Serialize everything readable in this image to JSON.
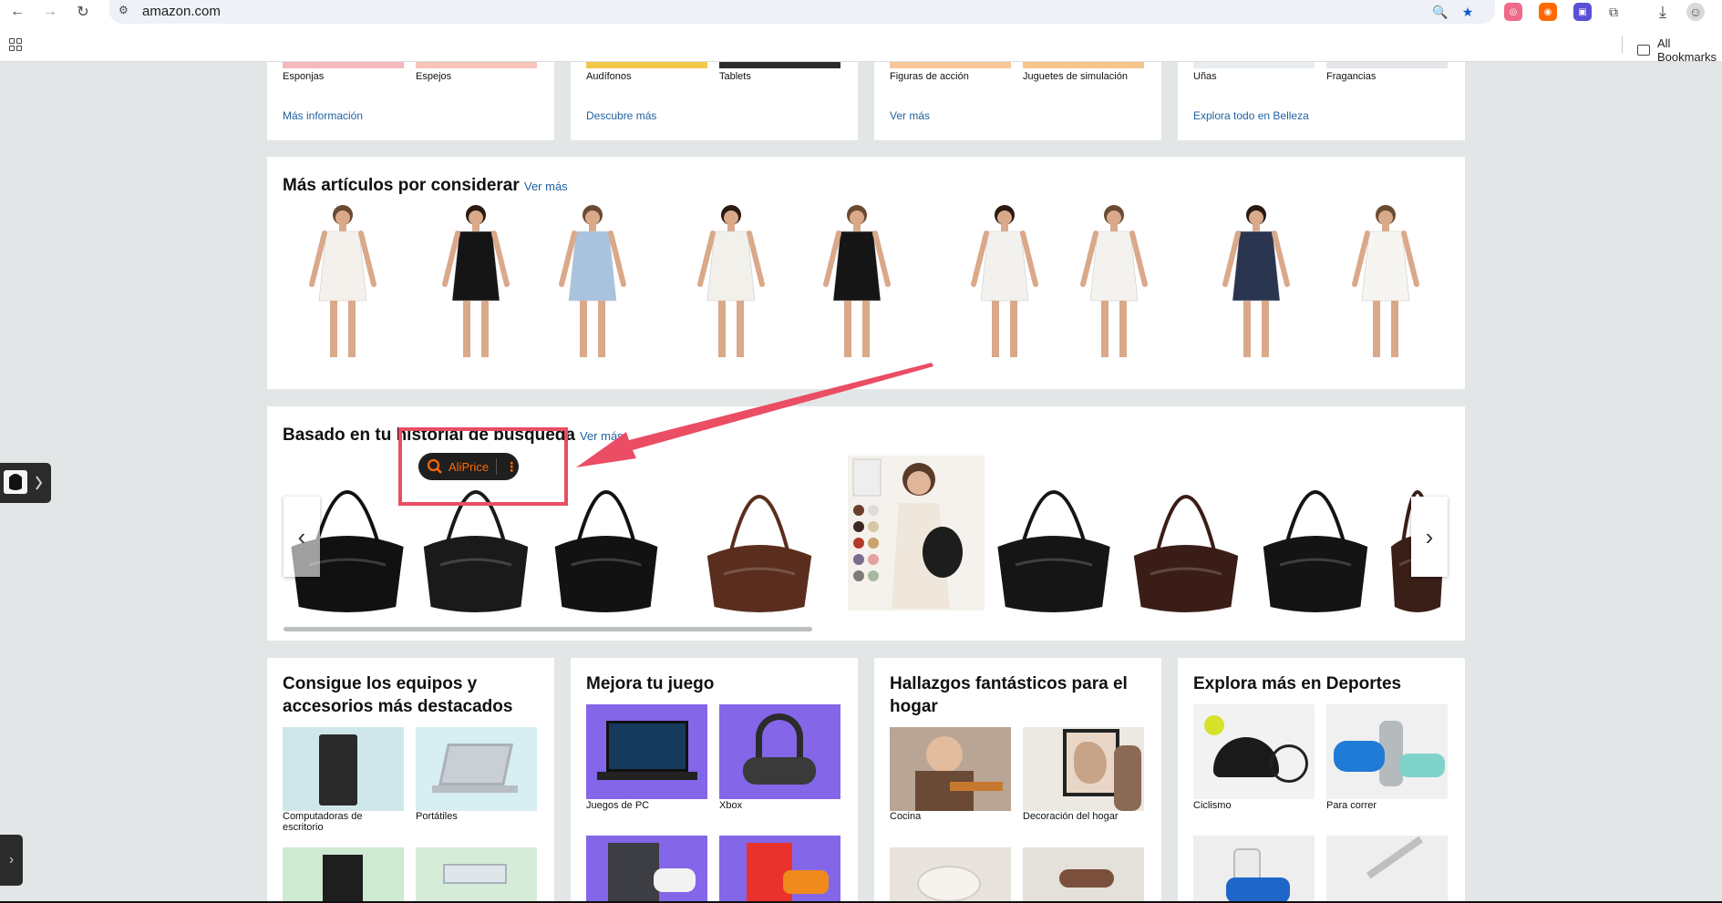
{
  "browser": {
    "url": "amazon.com",
    "bookmarks_label": "All Bookmarks",
    "extensions": [
      {
        "name": "extension-pink-icon",
        "color": "#f06a8a"
      },
      {
        "name": "extension-orange-icon",
        "color": "#ff6a00"
      },
      {
        "name": "extension-purple-icon",
        "color": "#5b4fd6"
      }
    ]
  },
  "top_cards": [
    {
      "labels": [
        "Esponjas",
        "Espejos"
      ],
      "link": "Más información"
    },
    {
      "labels": [
        "Audífonos",
        "Tablets"
      ],
      "link": "Descubre más"
    },
    {
      "labels": [
        "Figuras de acción",
        "Juguetes de simulación"
      ],
      "link": "Ver más"
    },
    {
      "labels": [
        "Uñas",
        "Fragancias"
      ],
      "link": "Explora todo en Belleza"
    }
  ],
  "more_items": {
    "title": "Más artículos por considerar",
    "link": "Ver más",
    "dresses": [
      {
        "name": "dress-white-long",
        "color": "#f4f1ec"
      },
      {
        "name": "dress-black-square",
        "color": "#151515"
      },
      {
        "name": "dress-light-blue",
        "color": "#a9c3de"
      },
      {
        "name": "dress-white-ruffle-hat",
        "color": "#f2f0eb"
      },
      {
        "name": "dress-black-long-sleeve",
        "color": "#151515"
      },
      {
        "name": "dress-white-maxi",
        "color": "#f3f1ee"
      },
      {
        "name": "dress-white-tiered",
        "color": "#f4f2ef"
      },
      {
        "name": "dress-navy-floral",
        "color": "#2a3550"
      },
      {
        "name": "dress-white-lace",
        "color": "#f6f5f2"
      }
    ]
  },
  "history": {
    "title": "Basado en tu historial de búsqueda",
    "link": "Ver más",
    "bags": [
      {
        "name": "bag-black-hobo",
        "color": "#111111"
      },
      {
        "name": "bag-black-hobo-2",
        "color": "#1a1a1a"
      },
      {
        "name": "bag-black-crescent",
        "color": "#121212"
      },
      {
        "name": "bag-brown-shoulder",
        "color": "#5a2e1e"
      },
      {
        "name": "bag-model-color-options",
        "color": "#1d1d1d"
      },
      {
        "name": "bag-black-shoulder",
        "color": "#151515"
      },
      {
        "name": "bag-dark-brown-shoulder",
        "color": "#3b1d17"
      },
      {
        "name": "bag-black-shoulder-2",
        "color": "#141414"
      },
      {
        "name": "bag-dark-brown-partial",
        "color": "#3a1e18"
      }
    ]
  },
  "aliprice": {
    "label": "AliPrice"
  },
  "bottom_cards": [
    {
      "title": "Consigue los equipos y accesorios más destacados",
      "tiles": [
        {
          "label": "Computadoras de escritorio",
          "bg": "#cfe7ea"
        },
        {
          "label": "Portátiles",
          "bg": "#d7eef2"
        },
        {
          "label": "",
          "bg": "#cfe9d2"
        },
        {
          "label": "",
          "bg": "#d5ecd8"
        }
      ]
    },
    {
      "title": "Mejora tu juego",
      "tiles": [
        {
          "label": "Juegos de PC",
          "bg": "#8466e8"
        },
        {
          "label": "Xbox",
          "bg": "#8466e8"
        },
        {
          "label": "",
          "bg": "#8466e8"
        },
        {
          "label": "",
          "bg": "#8466e8"
        }
      ]
    },
    {
      "title": "Hallazgos fantásticos para el hogar",
      "tiles": [
        {
          "label": "Cocina",
          "bg": "#b9a595"
        },
        {
          "label": "Decoración del hogar",
          "bg": "#ece8e2"
        },
        {
          "label": "",
          "bg": "#e8e3dc"
        },
        {
          "label": "",
          "bg": "#e4e0da"
        }
      ]
    },
    {
      "title": "Explora más en Deportes",
      "tiles": [
        {
          "label": "Ciclismo",
          "bg": "#f2f2f2"
        },
        {
          "label": "Para correr",
          "bg": "#f0f0f0"
        },
        {
          "label": "",
          "bg": "#eeeeee"
        },
        {
          "label": "",
          "bg": "#eeeeee"
        }
      ]
    }
  ],
  "colors": {
    "accent_arrow": "#ea4d64",
    "link": "#2162a1",
    "page_bg": "#e3e6e6"
  }
}
